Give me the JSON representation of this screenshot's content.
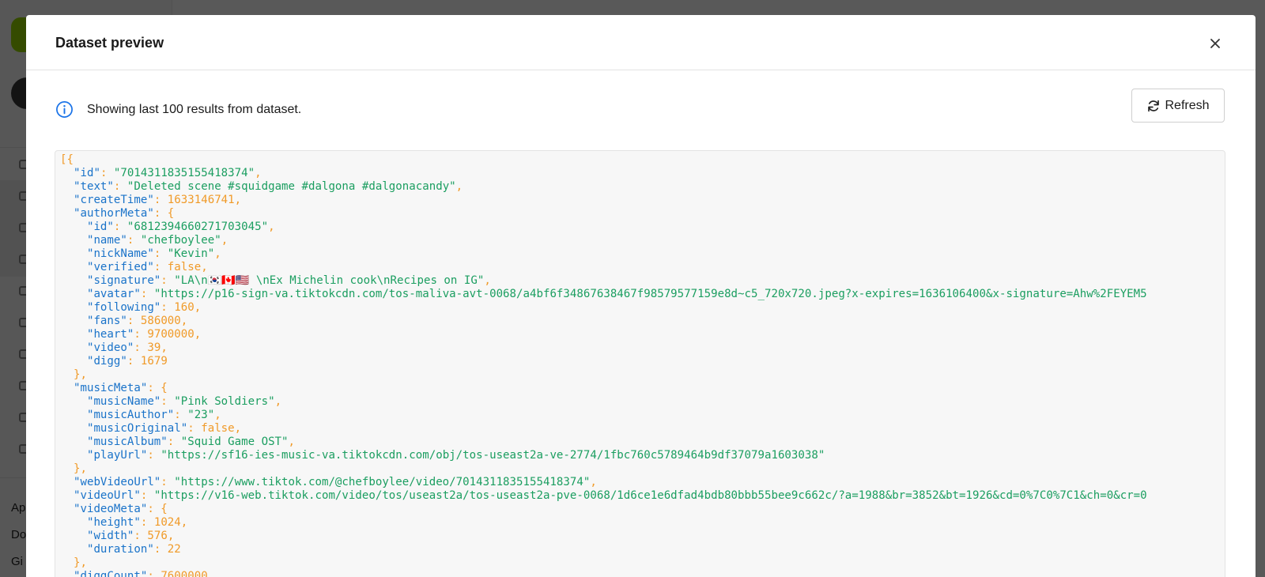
{
  "modal": {
    "title": "Dataset preview",
    "info_text": "Showing last 100 results from dataset.",
    "refresh_label": "Refresh"
  },
  "background": {
    "sidebar_texts": [
      "Ap",
      "Do",
      "Gi"
    ]
  },
  "code": {
    "lines": [
      [
        [
          "p",
          "[{"
        ]
      ],
      [
        [
          "p",
          "  "
        ],
        [
          "k",
          "\"id\""
        ],
        [
          "p",
          ": "
        ],
        [
          "s",
          "\"7014311835155418374\""
        ],
        [
          "p",
          ","
        ]
      ],
      [
        [
          "p",
          "  "
        ],
        [
          "k",
          "\"text\""
        ],
        [
          "p",
          ": "
        ],
        [
          "s",
          "\"Deleted scene #squidgame #dalgona #dalgonacandy\""
        ],
        [
          "p",
          ","
        ]
      ],
      [
        [
          "p",
          "  "
        ],
        [
          "k",
          "\"createTime\""
        ],
        [
          "p",
          ": "
        ],
        [
          "n",
          "1633146741"
        ],
        [
          "p",
          ","
        ]
      ],
      [
        [
          "p",
          "  "
        ],
        [
          "k",
          "\"authorMeta\""
        ],
        [
          "p",
          ": {"
        ]
      ],
      [
        [
          "p",
          "    "
        ],
        [
          "k",
          "\"id\""
        ],
        [
          "p",
          ": "
        ],
        [
          "s",
          "\"6812394660271703045\""
        ],
        [
          "p",
          ","
        ]
      ],
      [
        [
          "p",
          "    "
        ],
        [
          "k",
          "\"name\""
        ],
        [
          "p",
          ": "
        ],
        [
          "s",
          "\"chefboylee\""
        ],
        [
          "p",
          ","
        ]
      ],
      [
        [
          "p",
          "    "
        ],
        [
          "k",
          "\"nickName\""
        ],
        [
          "p",
          ": "
        ],
        [
          "s",
          "\"Kevin\""
        ],
        [
          "p",
          ","
        ]
      ],
      [
        [
          "p",
          "    "
        ],
        [
          "k",
          "\"verified\""
        ],
        [
          "p",
          ": "
        ],
        [
          "n",
          "false"
        ],
        [
          "p",
          ","
        ]
      ],
      [
        [
          "p",
          "    "
        ],
        [
          "k",
          "\"signature\""
        ],
        [
          "p",
          ": "
        ],
        [
          "s",
          "\"LA\\n🇰🇷🇨🇦🇺🇸 \\nEx Michelin cook\\nRecipes on IG\""
        ],
        [
          "p",
          ","
        ]
      ],
      [
        [
          "p",
          "    "
        ],
        [
          "k",
          "\"avatar\""
        ],
        [
          "p",
          ": "
        ],
        [
          "s",
          "\"https://p16-sign-va.tiktokcdn.com/tos-maliva-avt-0068/a4bf6f34867638467f98579577159e8d~c5_720x720.jpeg?x-expires=1636106400&x-signature=Ahw%2FEYEM5"
        ]
      ],
      [
        [
          "p",
          "    "
        ],
        [
          "k",
          "\"following\""
        ],
        [
          "p",
          ": "
        ],
        [
          "n",
          "160"
        ],
        [
          "p",
          ","
        ]
      ],
      [
        [
          "p",
          "    "
        ],
        [
          "k",
          "\"fans\""
        ],
        [
          "p",
          ": "
        ],
        [
          "n",
          "586000"
        ],
        [
          "p",
          ","
        ]
      ],
      [
        [
          "p",
          "    "
        ],
        [
          "k",
          "\"heart\""
        ],
        [
          "p",
          ": "
        ],
        [
          "n",
          "9700000"
        ],
        [
          "p",
          ","
        ]
      ],
      [
        [
          "p",
          "    "
        ],
        [
          "k",
          "\"video\""
        ],
        [
          "p",
          ": "
        ],
        [
          "n",
          "39"
        ],
        [
          "p",
          ","
        ]
      ],
      [
        [
          "p",
          "    "
        ],
        [
          "k",
          "\"digg\""
        ],
        [
          "p",
          ": "
        ],
        [
          "n",
          "1679"
        ]
      ],
      [
        [
          "p",
          "  },"
        ]
      ],
      [
        [
          "p",
          "  "
        ],
        [
          "k",
          "\"musicMeta\""
        ],
        [
          "p",
          ": {"
        ]
      ],
      [
        [
          "p",
          "    "
        ],
        [
          "k",
          "\"musicName\""
        ],
        [
          "p",
          ": "
        ],
        [
          "s",
          "\"Pink Soldiers\""
        ],
        [
          "p",
          ","
        ]
      ],
      [
        [
          "p",
          "    "
        ],
        [
          "k",
          "\"musicAuthor\""
        ],
        [
          "p",
          ": "
        ],
        [
          "s",
          "\"23\""
        ],
        [
          "p",
          ","
        ]
      ],
      [
        [
          "p",
          "    "
        ],
        [
          "k",
          "\"musicOriginal\""
        ],
        [
          "p",
          ": "
        ],
        [
          "n",
          "false"
        ],
        [
          "p",
          ","
        ]
      ],
      [
        [
          "p",
          "    "
        ],
        [
          "k",
          "\"musicAlbum\""
        ],
        [
          "p",
          ": "
        ],
        [
          "s",
          "\"Squid Game OST\""
        ],
        [
          "p",
          ","
        ]
      ],
      [
        [
          "p",
          "    "
        ],
        [
          "k",
          "\"playUrl\""
        ],
        [
          "p",
          ": "
        ],
        [
          "s",
          "\"https://sf16-ies-music-va.tiktokcdn.com/obj/tos-useast2a-ve-2774/1fbc760c5789464b9df37079a1603038\""
        ]
      ],
      [
        [
          "p",
          "  },"
        ]
      ],
      [
        [
          "p",
          "  "
        ],
        [
          "k",
          "\"webVideoUrl\""
        ],
        [
          "p",
          ": "
        ],
        [
          "s",
          "\"https://www.tiktok.com/@chefboylee/video/7014311835155418374\""
        ],
        [
          "p",
          ","
        ]
      ],
      [
        [
          "p",
          "  "
        ],
        [
          "k",
          "\"videoUrl\""
        ],
        [
          "p",
          ": "
        ],
        [
          "s",
          "\"https://v16-web.tiktok.com/video/tos/useast2a/tos-useast2a-pve-0068/1d6ce1e6dfad4bdb80bbb55bee9c662c/?a=1988&br=3852&bt=1926&cd=0%7C0%7C1&ch=0&cr=0"
        ]
      ],
      [
        [
          "p",
          "  "
        ],
        [
          "k",
          "\"videoMeta\""
        ],
        [
          "p",
          ": {"
        ]
      ],
      [
        [
          "p",
          "    "
        ],
        [
          "k",
          "\"height\""
        ],
        [
          "p",
          ": "
        ],
        [
          "n",
          "1024"
        ],
        [
          "p",
          ","
        ]
      ],
      [
        [
          "p",
          "    "
        ],
        [
          "k",
          "\"width\""
        ],
        [
          "p",
          ": "
        ],
        [
          "n",
          "576"
        ],
        [
          "p",
          ","
        ]
      ],
      [
        [
          "p",
          "    "
        ],
        [
          "k",
          "\"duration\""
        ],
        [
          "p",
          ": "
        ],
        [
          "n",
          "22"
        ]
      ],
      [
        [
          "p",
          "  },"
        ]
      ],
      [
        [
          "p",
          "  "
        ],
        [
          "k",
          "\"diggCount\""
        ],
        [
          "p",
          ": "
        ],
        [
          "n",
          "7600000"
        ],
        [
          "p",
          ","
        ]
      ]
    ]
  }
}
